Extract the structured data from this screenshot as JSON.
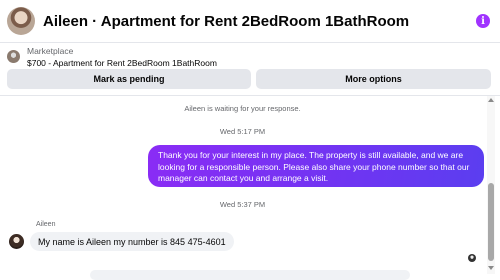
{
  "header": {
    "title": "Aileen · Apartment for Rent 2BedRoom 1BathRoom",
    "info_icon": "info-icon",
    "accent_color": "#a033ff"
  },
  "listing": {
    "label": "Marketplace",
    "title": "$700 - Apartment for Rent 2BedRoom 1BathRoom"
  },
  "actions": {
    "mark_pending": "Mark as pending",
    "more_options": "More options"
  },
  "chat": {
    "waiting_notice": "Aileen is waiting for your response.",
    "messages": [
      {
        "timestamp": "Wed 5:17 PM",
        "direction": "outgoing",
        "text": "Thank you for your interest in my place. The property is still available, and we are looking for a responsible person. Please also share your phone number so that our manager can contact you and arrange a visit."
      },
      {
        "timestamp": "Wed 5:37 PM",
        "direction": "incoming",
        "sender": "Aileen",
        "text": "My name is Aileen my number is 845 475-4601"
      }
    ],
    "outgoing_color": "#7a32f3",
    "incoming_color": "#f0f2f5"
  }
}
